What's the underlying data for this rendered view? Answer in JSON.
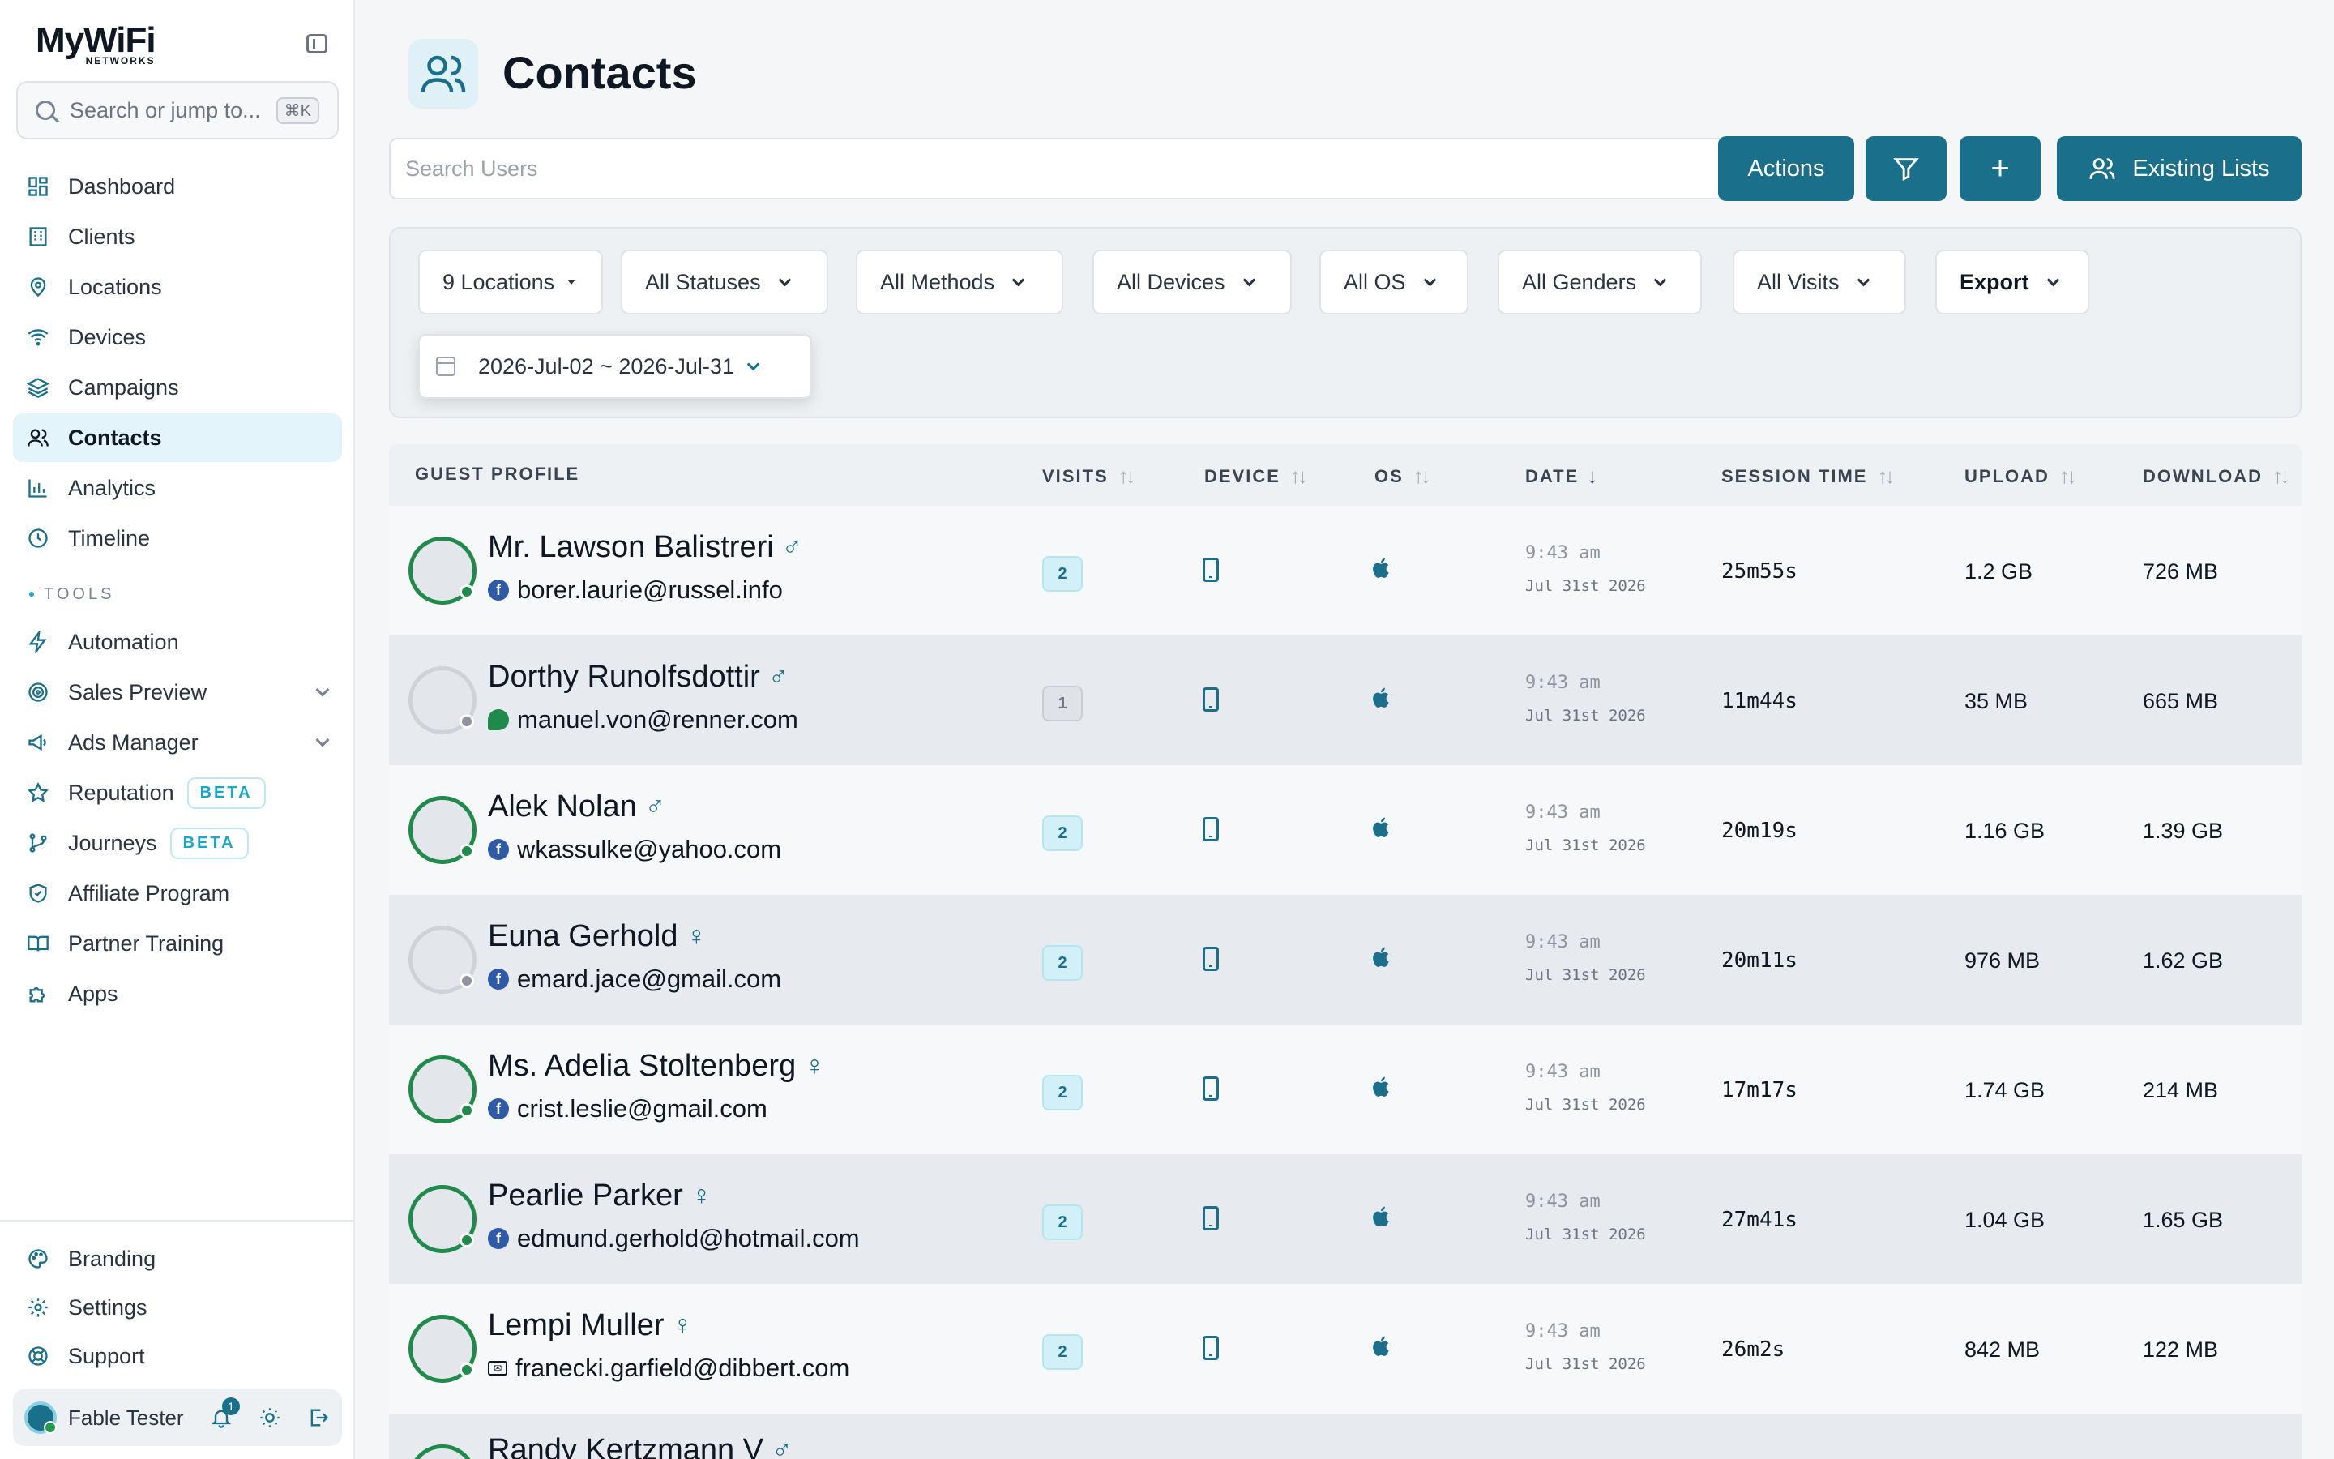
{
  "brand": {
    "name": "MyWiFi",
    "sub": "NETWORKS"
  },
  "sidebar": {
    "search_placeholder": "Search or jump to...",
    "search_shortcut": "⌘K",
    "nav": [
      {
        "label": "Dashboard",
        "icon": "dashboard-icon"
      },
      {
        "label": "Clients",
        "icon": "building-icon"
      },
      {
        "label": "Locations",
        "icon": "map-pin-icon"
      },
      {
        "label": "Devices",
        "icon": "wifi-icon"
      },
      {
        "label": "Campaigns",
        "icon": "layers-icon"
      },
      {
        "label": "Contacts",
        "icon": "users-icon",
        "active": true
      },
      {
        "label": "Analytics",
        "icon": "bar-chart-icon"
      },
      {
        "label": "Timeline",
        "icon": "clock-icon"
      }
    ],
    "tools_label": "TOOLS",
    "tools": [
      {
        "label": "Automation",
        "icon": "bolt-icon"
      },
      {
        "label": "Sales Preview",
        "icon": "target-icon",
        "expand": true
      },
      {
        "label": "Ads Manager",
        "icon": "megaphone-icon",
        "expand": true
      },
      {
        "label": "Reputation",
        "icon": "star-icon",
        "badge": "BETA"
      },
      {
        "label": "Journeys",
        "icon": "branch-icon",
        "badge": "BETA"
      },
      {
        "label": "Affiliate Program",
        "icon": "shield-icon"
      },
      {
        "label": "Partner Training",
        "icon": "book-icon"
      },
      {
        "label": "Apps",
        "icon": "puzzle-icon"
      }
    ],
    "bottom": [
      {
        "label": "Branding",
        "icon": "palette-icon"
      },
      {
        "label": "Settings",
        "icon": "gear-icon"
      },
      {
        "label": "Support",
        "icon": "lifebuoy-icon"
      }
    ],
    "user": {
      "name": "Fable Tester",
      "notifications": "1"
    }
  },
  "page": {
    "title": "Contacts"
  },
  "toolbar": {
    "search_placeholder": "Search Users",
    "actions_label": "Actions",
    "add_label": "+",
    "existing_lists_label": "Existing Lists"
  },
  "filters": {
    "locations": "9 Locations",
    "statuses": "All Statuses",
    "methods": "All Methods",
    "devices": "All Devices",
    "os": "All OS",
    "genders": "All Genders",
    "visits": "All Visits",
    "export": "Export",
    "date_range": "2026-Jul-02 ~ 2026-Jul-31"
  },
  "table": {
    "headers": {
      "profile": "GUEST PROFILE",
      "visits": "VISITS",
      "device": "DEVICE",
      "os": "OS",
      "date": "DATE",
      "session": "SESSION TIME",
      "upload": "UPLOAD",
      "download": "DOWNLOAD"
    },
    "rows": [
      {
        "name": "Mr. Lawson Balistreri",
        "gender": "♂",
        "email": "borer.laurie@russel.info",
        "source": "facebook",
        "online": true,
        "visits": "2",
        "time": "9:43 am",
        "date": "Jul 31st 2026",
        "session": "25m55s",
        "upload": "1.2 GB",
        "download": "726 MB"
      },
      {
        "name": "Dorthy Runolfsdottir",
        "gender": "♂",
        "email": "manuel.von@renner.com",
        "source": "chat",
        "online": false,
        "visits": "1",
        "time": "9:43 am",
        "date": "Jul 31st 2026",
        "session": "11m44s",
        "upload": "35 MB",
        "download": "665 MB"
      },
      {
        "name": "Alek Nolan",
        "gender": "♂",
        "email": "wkassulke@yahoo.com",
        "source": "facebook",
        "online": true,
        "visits": "2",
        "time": "9:43 am",
        "date": "Jul 31st 2026",
        "session": "20m19s",
        "upload": "1.16 GB",
        "download": "1.39 GB"
      },
      {
        "name": "Euna Gerhold",
        "gender": "♀",
        "email": "emard.jace@gmail.com",
        "source": "facebook",
        "online": false,
        "visits": "2",
        "time": "9:43 am",
        "date": "Jul 31st 2026",
        "session": "20m11s",
        "upload": "976 MB",
        "download": "1.62 GB"
      },
      {
        "name": "Ms. Adelia Stoltenberg",
        "gender": "♀",
        "email": "crist.leslie@gmail.com",
        "source": "facebook",
        "online": true,
        "visits": "2",
        "time": "9:43 am",
        "date": "Jul 31st 2026",
        "session": "17m17s",
        "upload": "1.74 GB",
        "download": "214 MB"
      },
      {
        "name": "Pearlie Parker",
        "gender": "♀",
        "email": "edmund.gerhold@hotmail.com",
        "source": "facebook",
        "online": true,
        "visits": "2",
        "time": "9:43 am",
        "date": "Jul 31st 2026",
        "session": "27m41s",
        "upload": "1.04 GB",
        "download": "1.65 GB"
      },
      {
        "name": "Lempi Muller",
        "gender": "♀",
        "email": "franecki.garfield@dibbert.com",
        "source": "email",
        "online": true,
        "visits": "2",
        "time": "9:43 am",
        "date": "Jul 31st 2026",
        "session": "26m2s",
        "upload": "842 MB",
        "download": "122 MB"
      },
      {
        "name": "Randy Kertzmann V",
        "gender": "♂",
        "email": "",
        "source": "",
        "online": true,
        "visits": "",
        "time": "",
        "date": "",
        "session": "",
        "upload": "",
        "download": ""
      }
    ]
  },
  "colors": {
    "accent": "#1a6f8a",
    "online": "#1f8a4a",
    "facebook": "#2f5aa8"
  }
}
